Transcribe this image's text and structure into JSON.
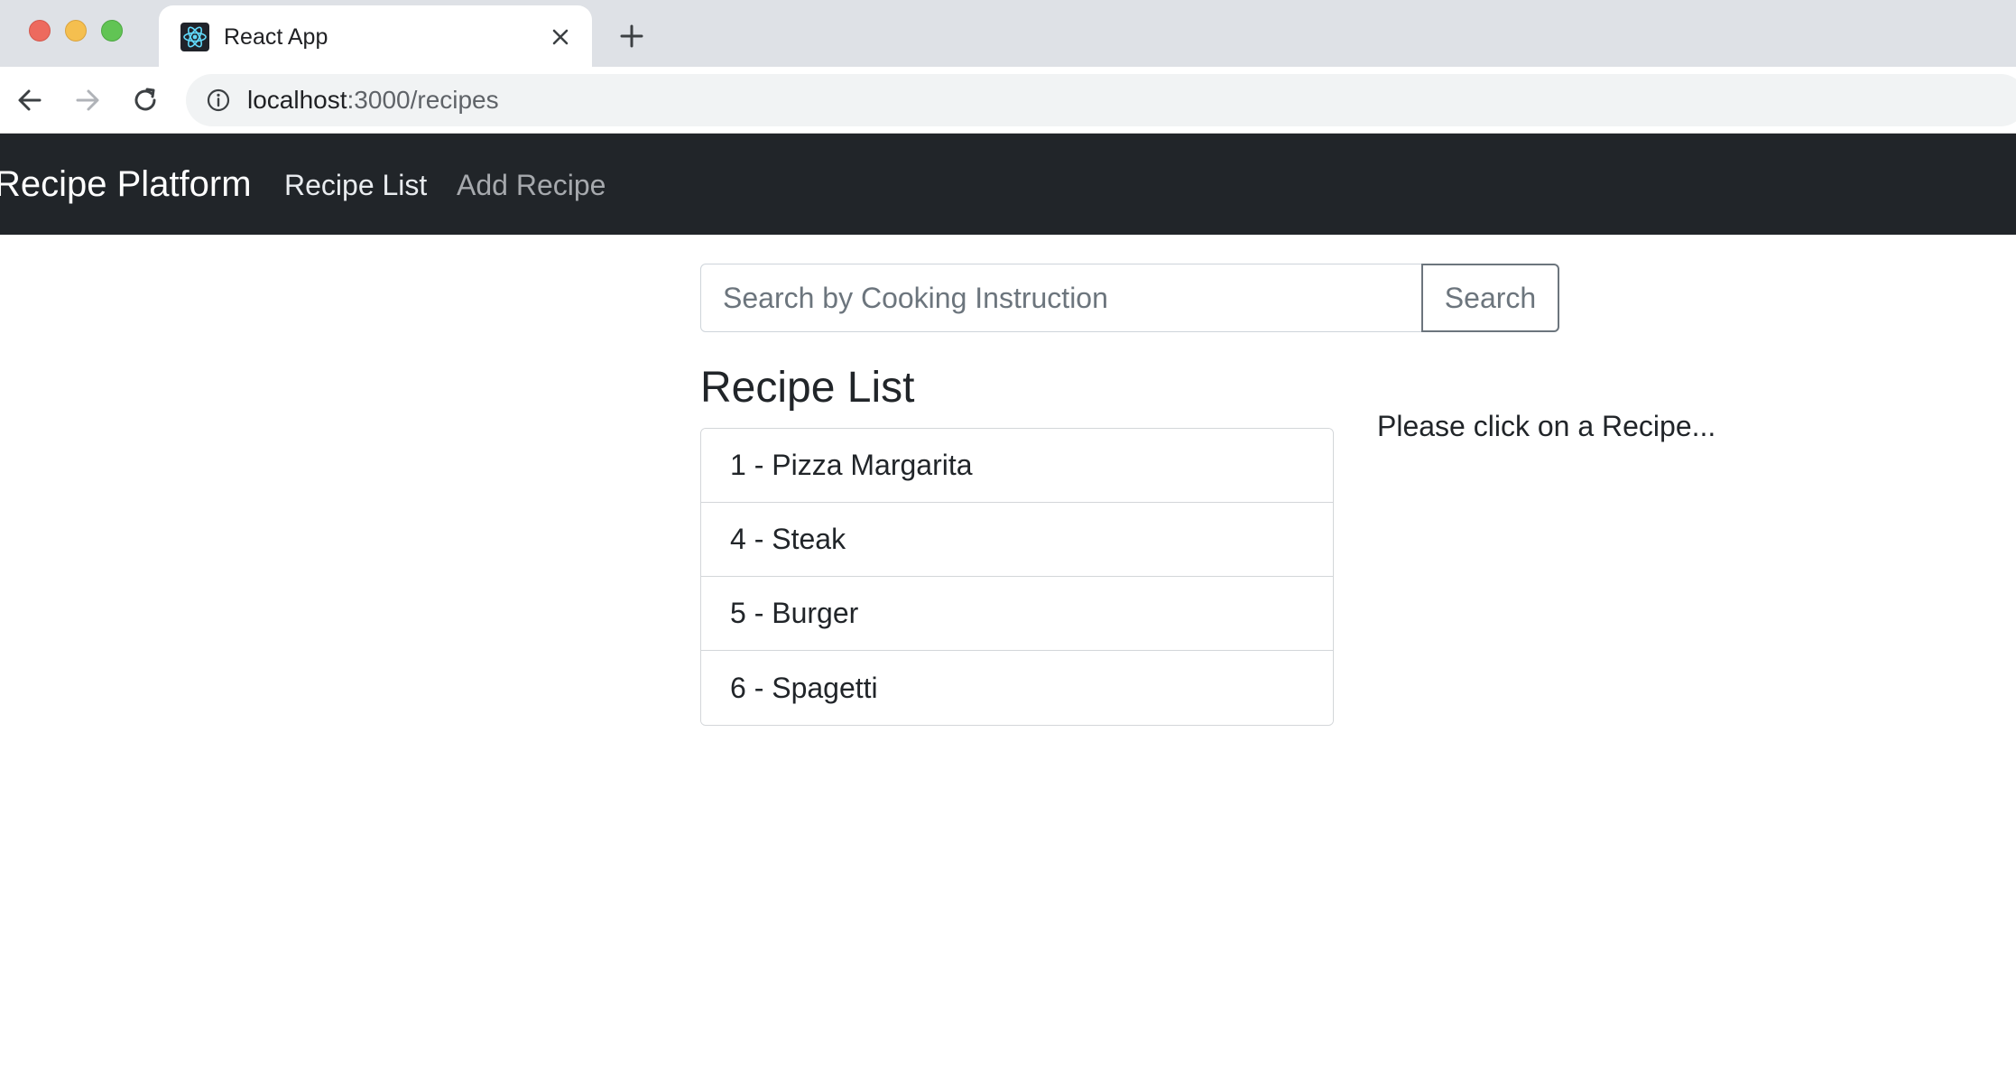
{
  "browser": {
    "tab_title": "React App",
    "url_host": "localhost",
    "url_path": ":3000/recipes",
    "icons": {
      "favicon": "react-logo-icon",
      "close": "close-icon",
      "new_tab": "plus-icon",
      "back": "arrow-left-icon",
      "forward": "arrow-right-icon",
      "reload": "reload-icon",
      "info": "info-icon"
    }
  },
  "navbar": {
    "brand": "Recipe Platform",
    "links": [
      {
        "label": "Recipe List",
        "active": true
      },
      {
        "label": "Add Recipe",
        "active": false
      }
    ]
  },
  "search": {
    "placeholder": "Search by Cooking Instruction",
    "value": "",
    "button_label": "Search"
  },
  "recipe_list": {
    "title": "Recipe List",
    "items": [
      {
        "label": "1 - Pizza Margarita"
      },
      {
        "label": "4 - Steak"
      },
      {
        "label": "5 - Burger"
      },
      {
        "label": "6 - Spagetti"
      }
    ]
  },
  "detail": {
    "hint": "Please click on a Recipe..."
  },
  "colors": {
    "navbar_bg": "#212529",
    "tabbar_bg": "#dee1e6",
    "button_outline": "#6c757d"
  }
}
